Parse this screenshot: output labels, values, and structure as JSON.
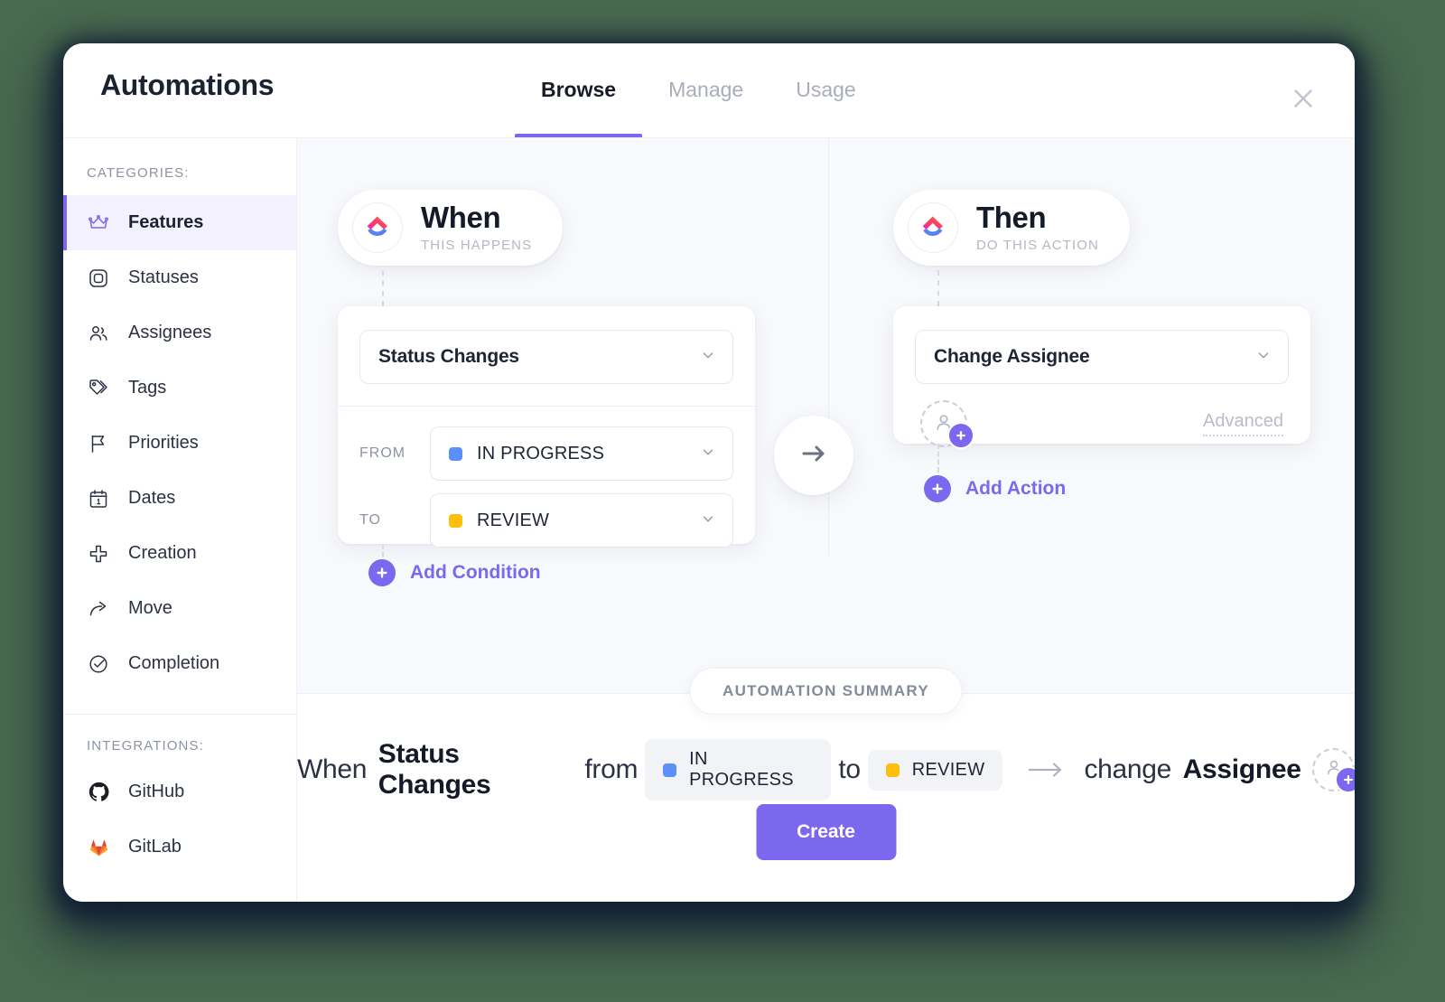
{
  "window": {
    "title": "Automations",
    "close_icon": "close-icon"
  },
  "tabs": [
    {
      "label": "Browse",
      "active": true
    },
    {
      "label": "Manage",
      "active": false
    },
    {
      "label": "Usage",
      "active": false
    }
  ],
  "sidebar": {
    "categories_heading": "CATEGORIES:",
    "integrations_heading": "INTEGRATIONS:",
    "items": [
      {
        "label": "Features",
        "icon": "crown-icon",
        "active": true
      },
      {
        "label": "Statuses",
        "icon": "rounded-square-icon",
        "active": false
      },
      {
        "label": "Assignees",
        "icon": "people-icon",
        "active": false
      },
      {
        "label": "Tags",
        "icon": "tag-icon",
        "active": false
      },
      {
        "label": "Priorities",
        "icon": "flag-icon",
        "active": false
      },
      {
        "label": "Dates",
        "icon": "calendar-icon",
        "active": false
      },
      {
        "label": "Creation",
        "icon": "plus-icon",
        "active": false
      },
      {
        "label": "Move",
        "icon": "share-arrow-icon",
        "active": false
      },
      {
        "label": "Completion",
        "icon": "check-circle-icon",
        "active": false
      }
    ],
    "integrations": [
      {
        "label": "GitHub",
        "icon": "github-icon"
      },
      {
        "label": "GitLab",
        "icon": "gitlab-icon"
      }
    ]
  },
  "builder": {
    "when": {
      "title": "When",
      "subtitle": "THIS HAPPENS",
      "logo_icon": "clickup-logo-icon",
      "trigger": {
        "value": "Status Changes",
        "chevron_icon": "chevron-down-icon"
      },
      "from": {
        "label": "FROM",
        "value": "IN PROGRESS",
        "color": "#5B8FF9",
        "chevron_icon": "chevron-down-icon"
      },
      "to": {
        "label": "TO",
        "value": "REVIEW",
        "color": "#FFBE0B",
        "chevron_icon": "chevron-down-icon"
      },
      "add_condition": {
        "label": "Add Condition",
        "icon": "plus-circle-icon"
      }
    },
    "flow_arrow_icon": "arrow-right-icon",
    "then": {
      "title": "Then",
      "subtitle": "DO THIS ACTION",
      "logo_icon": "clickup-logo-icon",
      "action": {
        "value": "Change Assignee",
        "chevron_icon": "chevron-down-icon"
      },
      "assignee_picker": {
        "icon": "user-add-icon"
      },
      "advanced_label": "Advanced",
      "add_action": {
        "label": "Add Action",
        "icon": "plus-circle-icon"
      }
    }
  },
  "summary": {
    "pill_label": "AUTOMATION SUMMARY",
    "when_word": "When",
    "trigger_bold": "Status Changes",
    "from_word": "from",
    "from_status": {
      "value": "IN PROGRESS",
      "color": "#5B8FF9"
    },
    "to_word": "to",
    "to_status": {
      "value": "REVIEW",
      "color": "#FFBE0B"
    },
    "arrow_icon": "arrow-right-icon",
    "change_word": "change",
    "action_bold": "Assignee",
    "assignee_icon": "user-add-icon",
    "create_label": "Create"
  },
  "colors": {
    "accent": "#7B68EE",
    "canvas_bg": "#F8F9FC",
    "text_dark": "#141A27",
    "text_muted": "#8D93A3"
  }
}
